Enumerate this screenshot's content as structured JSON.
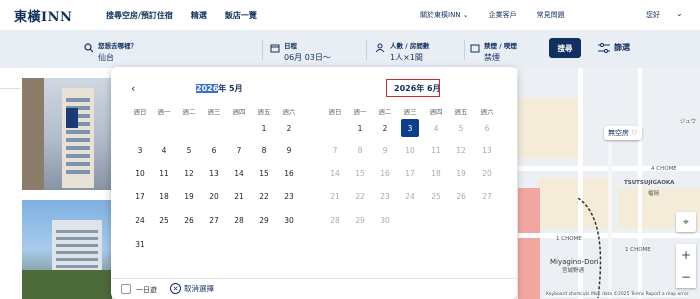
{
  "header": {
    "logo": "東橫INN",
    "nav": [
      "搜尋空房/預訂住宿",
      "精選",
      "飯店一覽"
    ],
    "right_nav": [
      "關於東橫INN",
      "企業客戶",
      "常見問題"
    ],
    "user": "您好"
  },
  "search": {
    "destination_label": "您想去哪裡？",
    "destination_value": "仙台",
    "date_label": "日程",
    "date_value": "06月 03日〜",
    "guests_label": "人數 / 房間數",
    "guests_value": "1人×1間",
    "smoking_label": "禁煙 / 喫煙",
    "smoking_value": "禁煙",
    "search_button": "搜尋",
    "filter_button": "篩選"
  },
  "calendar": {
    "left_title_year": "2026",
    "left_title_rest": "年 5月",
    "right_title": "2026年 6月",
    "weekdays": [
      "週日",
      "週一",
      "週二",
      "週三",
      "週四",
      "週五",
      "週六"
    ],
    "may_days": [
      "1",
      "2",
      "3",
      "4",
      "5",
      "6",
      "7",
      "8",
      "9",
      "10",
      "11",
      "12",
      "13",
      "14",
      "15",
      "16",
      "17",
      "18",
      "19",
      "20",
      "21",
      "22",
      "23",
      "24",
      "25",
      "26",
      "27",
      "28",
      "29",
      "30",
      "31"
    ],
    "june_days": [
      "1",
      "2",
      "3",
      "4",
      "5",
      "6",
      "7",
      "8",
      "9",
      "10",
      "11",
      "12",
      "13",
      "14",
      "15",
      "16",
      "17",
      "18",
      "19",
      "20",
      "21",
      "22",
      "23",
      "24",
      "25",
      "26",
      "27",
      "28",
      "29",
      "30"
    ],
    "one_day_label": "一日遊",
    "cancel_label": "取消選擇"
  },
  "map": {
    "pill": "無空房",
    "labels": [
      "4 CHOME",
      "TSUTSUJIGAOKA",
      "榴岡",
      "1 CHOME",
      "1 CHOME",
      "Miyagino-Dori",
      "宮城野通",
      "ジュウ"
    ],
    "attribution": "Keyboard shortcuts   Map data ©2025   Terms   Report a map error"
  }
}
